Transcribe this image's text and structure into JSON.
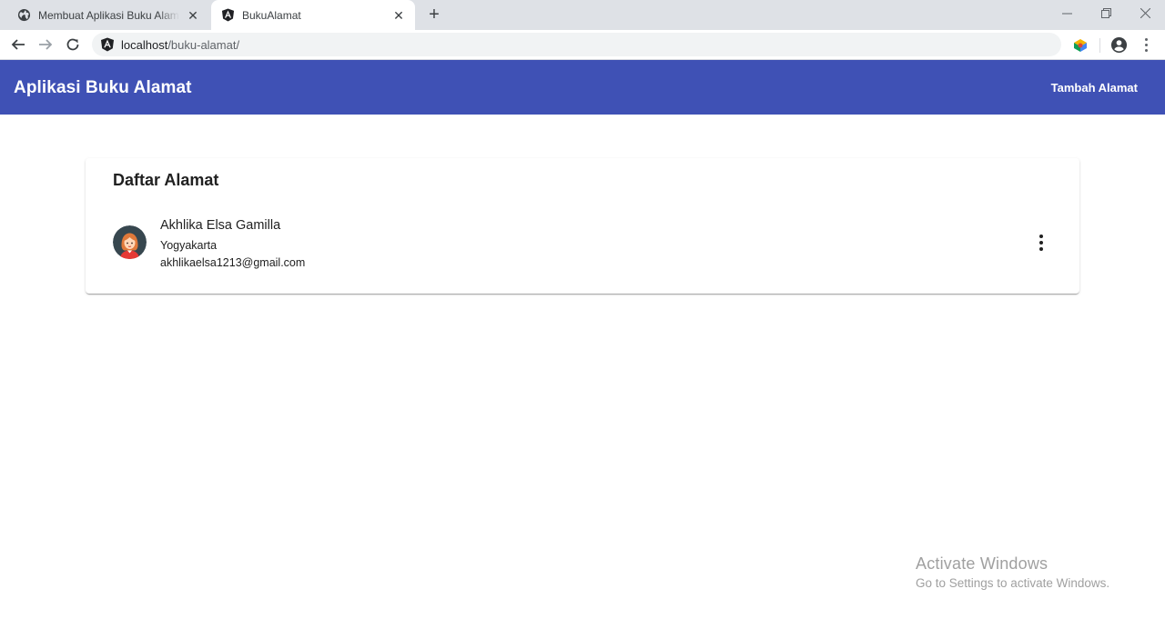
{
  "browser": {
    "tabs": [
      {
        "title": "Membuat Aplikasi Buku Alamat M",
        "icon": "globe-icon",
        "active": false
      },
      {
        "title": "BukuAlamat",
        "icon": "angular-icon",
        "active": true
      }
    ],
    "new_tab_label": "+",
    "url_host": "localhost",
    "url_path": "/buku-alamat/"
  },
  "app": {
    "title": "Aplikasi Buku Alamat",
    "add_button_label": "Tambah Alamat",
    "accent_color": "#3f51b5"
  },
  "card": {
    "title": "Daftar Alamat",
    "items": [
      {
        "name": "Akhlika Elsa Gamilla",
        "city": "Yogyakarta",
        "email": "akhlikaelsa1213@gmail.com",
        "avatar_icon": "female-avatar-icon"
      }
    ]
  },
  "watermark": {
    "title": "Activate Windows",
    "subtitle": "Go to Settings to activate Windows."
  }
}
